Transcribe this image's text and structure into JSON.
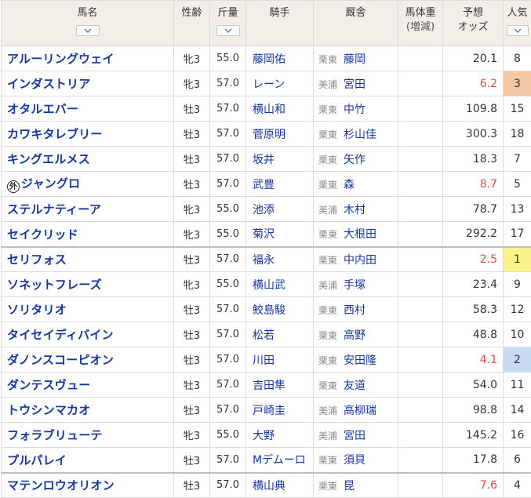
{
  "headers": {
    "horse": "馬名",
    "sex_age": "性齢",
    "weight": "斤量",
    "jockey": "騎手",
    "stable": "厩舎",
    "body_weight": "馬体重",
    "body_weight_sub": "(増減)",
    "odds_top": "予想",
    "odds_bottom": "オッズ",
    "popularity": "人気"
  },
  "foreign_mark": "外",
  "rows": [
    {
      "horse": "アルーリングウェイ",
      "sex_age": "牝3",
      "weight": "55.0",
      "jockey": "藤岡佑",
      "region": "栗東",
      "trainer": "藤岡",
      "odds": "20.1",
      "pop": "8"
    },
    {
      "horse": "インダストリア",
      "sex_age": "牝3",
      "weight": "57.0",
      "jockey": "レーン",
      "region": "美浦",
      "trainer": "宮田",
      "odds": "6.2",
      "pop": "3"
    },
    {
      "horse": "オタルエバー",
      "sex_age": "牡3",
      "weight": "57.0",
      "jockey": "横山和",
      "region": "栗東",
      "trainer": "中竹",
      "odds": "109.8",
      "pop": "15"
    },
    {
      "horse": "カワキタレブリー",
      "sex_age": "牡3",
      "weight": "57.0",
      "jockey": "菅原明",
      "region": "栗東",
      "trainer": "杉山佳",
      "odds": "300.3",
      "pop": "18"
    },
    {
      "horse": "キングエルメス",
      "sex_age": "牡3",
      "weight": "57.0",
      "jockey": "坂井",
      "region": "栗東",
      "trainer": "矢作",
      "odds": "18.3",
      "pop": "7"
    },
    {
      "horse": "ジャングロ",
      "sex_age": "牡3",
      "weight": "57.0",
      "jockey": "武豊",
      "region": "栗東",
      "trainer": "森",
      "odds": "8.7",
      "pop": "5"
    },
    {
      "horse": "ステルナティーア",
      "sex_age": "牝3",
      "weight": "55.0",
      "jockey": "池添",
      "region": "美浦",
      "trainer": "木村",
      "odds": "78.7",
      "pop": "13"
    },
    {
      "horse": "セイクリッド",
      "sex_age": "牝3",
      "weight": "55.0",
      "jockey": "菊沢",
      "region": "栗東",
      "trainer": "大根田",
      "odds": "292.2",
      "pop": "17"
    },
    {
      "horse": "セリフォス",
      "sex_age": "牡3",
      "weight": "57.0",
      "jockey": "福永",
      "region": "栗東",
      "trainer": "中内田",
      "odds": "2.5",
      "pop": "1"
    },
    {
      "horse": "ソネットフレーズ",
      "sex_age": "牝3",
      "weight": "55.0",
      "jockey": "横山武",
      "region": "美浦",
      "trainer": "手塚",
      "odds": "23.4",
      "pop": "9"
    },
    {
      "horse": "ソリタリオ",
      "sex_age": "牡3",
      "weight": "57.0",
      "jockey": "鮫島駿",
      "region": "栗東",
      "trainer": "西村",
      "odds": "58.3",
      "pop": "12"
    },
    {
      "horse": "タイセイディバイン",
      "sex_age": "牡3",
      "weight": "57.0",
      "jockey": "松若",
      "region": "栗東",
      "trainer": "高野",
      "odds": "48.8",
      "pop": "10"
    },
    {
      "horse": "ダノンスコーピオン",
      "sex_age": "牡3",
      "weight": "57.0",
      "jockey": "川田",
      "region": "栗東",
      "trainer": "安田隆",
      "odds": "4.1",
      "pop": "2"
    },
    {
      "horse": "ダンテスヴュー",
      "sex_age": "牡3",
      "weight": "57.0",
      "jockey": "吉田隼",
      "region": "栗東",
      "trainer": "友道",
      "odds": "54.0",
      "pop": "11"
    },
    {
      "horse": "トウシンマカオ",
      "sex_age": "牡3",
      "weight": "57.0",
      "jockey": "戸崎圭",
      "region": "美浦",
      "trainer": "高柳瑞",
      "odds": "98.8",
      "pop": "14"
    },
    {
      "horse": "フォラブリューテ",
      "sex_age": "牝3",
      "weight": "55.0",
      "jockey": "大野",
      "region": "美浦",
      "trainer": "宮田",
      "odds": "145.2",
      "pop": "16"
    },
    {
      "horse": "プルパレイ",
      "sex_age": "牡3",
      "weight": "57.0",
      "jockey": "Mデムーロ",
      "region": "栗東",
      "trainer": "須貝",
      "odds": "17.8",
      "pop": "6"
    },
    {
      "horse": "マテンロウオリオン",
      "sex_age": "牡3",
      "weight": "57.0",
      "jockey": "横山典",
      "region": "栗東",
      "trainer": "昆",
      "odds": "7.6",
      "pop": "4"
    }
  ],
  "colors": {
    "header_bg": "#f2efe9",
    "link": "#1535a0",
    "odds_favored": "#e04b4b",
    "pop1": "#fbf28c",
    "pop2": "#c7dbf6",
    "pop3": "#f3c7a3"
  }
}
